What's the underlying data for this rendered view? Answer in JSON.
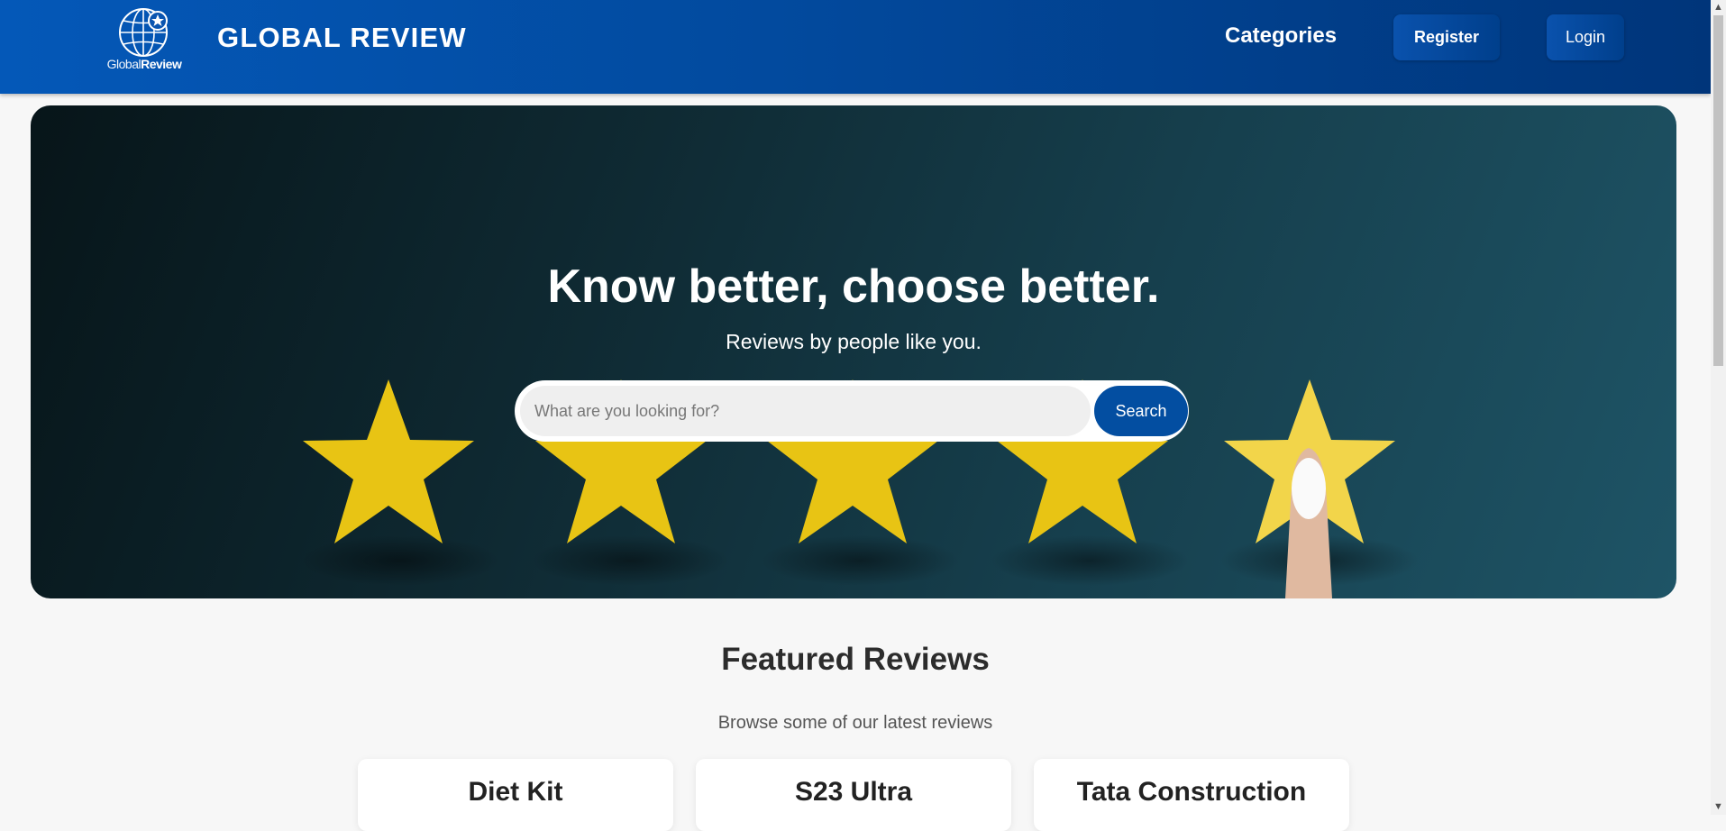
{
  "header": {
    "logo_text_light": "Global",
    "logo_text_bold": "Review",
    "brand_title": "GLOBAL REVIEW",
    "nav_categories": "Categories",
    "register_label": "Register",
    "login_label": "Login",
    "colors": {
      "header_start": "#0458b8",
      "header_end": "#00357a"
    }
  },
  "hero": {
    "title": "Know better, choose better.",
    "subtitle": "Reviews by people like you.",
    "search": {
      "placeholder": "What are you looking for?",
      "button_label": "Search"
    },
    "image_description_icons": [
      "star-icon",
      "star-icon",
      "star-icon",
      "star-icon",
      "star-icon",
      "finger-pointing"
    ],
    "colors": {
      "star": "#e8c414",
      "search_button": "#034ea1"
    }
  },
  "featured": {
    "title": "Featured Reviews",
    "subtitle": "Browse some of our latest reviews",
    "cards": [
      {
        "title": "Diet Kit"
      },
      {
        "title": "S23 Ultra"
      },
      {
        "title": "Tata Construction"
      }
    ]
  }
}
